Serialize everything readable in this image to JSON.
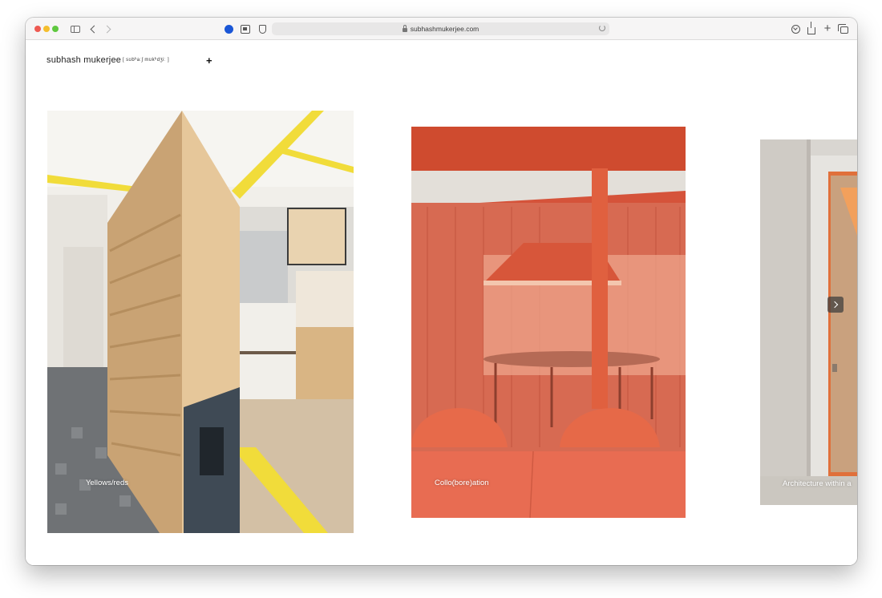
{
  "browser": {
    "url": "subhashmukerjee.com"
  },
  "site": {
    "title": "subhash mukerjee",
    "phonetic": "[ sʊbʰaːʃ mʊkʰdʒiː ]",
    "menu_glyph": "+"
  },
  "gallery": {
    "projects": [
      {
        "caption": "Yellows/reds"
      },
      {
        "caption": "Collo(bore)ation"
      },
      {
        "caption": "Architecture within a"
      }
    ],
    "next_icon": "chevron-right-icon"
  },
  "colors": {
    "accent_yellow": "#f1dc3a",
    "wood": "#e3c08e",
    "orange_red": "#d8583a"
  }
}
